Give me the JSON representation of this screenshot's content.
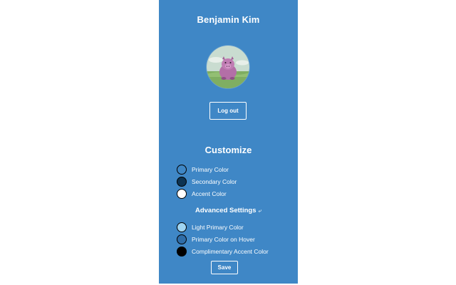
{
  "profile": {
    "name": "Benjamin Kim",
    "logout_label": "Log out"
  },
  "customize": {
    "title": "Customize",
    "colors": [
      {
        "label": "Primary Color",
        "value": "#3f87c6"
      },
      {
        "label": "Secondary Color",
        "value": "#0c3352"
      },
      {
        "label": "Accent Color",
        "value": "#ffffff"
      }
    ]
  },
  "advanced": {
    "title": "Advanced Settings",
    "icon": "return-arrow-icon",
    "colors": [
      {
        "label": "Light Primary Color",
        "value": "#9fd4f2"
      },
      {
        "label": "Primary Color on Hover",
        "value": "#2f6da8"
      },
      {
        "label": "Complimentary Accent Color",
        "value": "#000000"
      }
    ]
  },
  "save_label": "Save",
  "theme": {
    "panel_background": "#3f87c6",
    "page_background": "#ffffff",
    "text": "#ffffff"
  }
}
